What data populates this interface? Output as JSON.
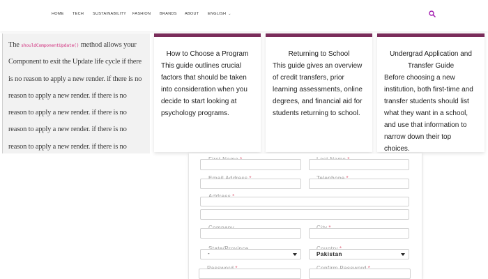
{
  "nav": {
    "items": [
      "HOME",
      "TECH",
      "SUSTAINABILITY",
      "FASHION",
      "BRANDS",
      "ABOUT"
    ],
    "language": "ENGLISH"
  },
  "left_panel": {
    "intro": "The",
    "code": "shouldComponentUpdate()",
    "text": "method allows your Component to exit the Update life cycle if there is no reason to apply a new render. if there is no reason to apply a new render. if there is no reason to apply a new render. if there is no reason to apply a new render. if there is no reason to apply a new render. if there is no reason to apply a new render. if there is no reason to apply a new render."
  },
  "cards": [
    {
      "title": "How to Choose a Program",
      "body": "This guide outlines crucial factors that should be taken into consideration when you decide to start looking at psychology programs."
    },
    {
      "title": "Returning to School",
      "body": "This guide gives an overview of credit transfers, prior learning assessments, online degrees, and financial aid for students returning to school."
    },
    {
      "title": "Undergrad Application and Transfer Guide",
      "body": "Before choosing a new institution, both first-time and transfer students should list what they want in a school, and use that information to narrow down their top choices."
    }
  ],
  "form": {
    "first_name": "First Name",
    "last_name": "Last Name",
    "email": "Email Address",
    "telephone": "Telephone",
    "address": "Address",
    "company": "Company",
    "city": "City",
    "state": "State/Province",
    "state_value": "-",
    "country": "Country",
    "country_value": "Pakistan",
    "password": "Password",
    "confirm_password": "Confirm Password",
    "required_mark": "*"
  },
  "colors": {
    "card_accent": "#7a2c5a",
    "search_icon": "#a21caf",
    "required": "#e06a80"
  }
}
